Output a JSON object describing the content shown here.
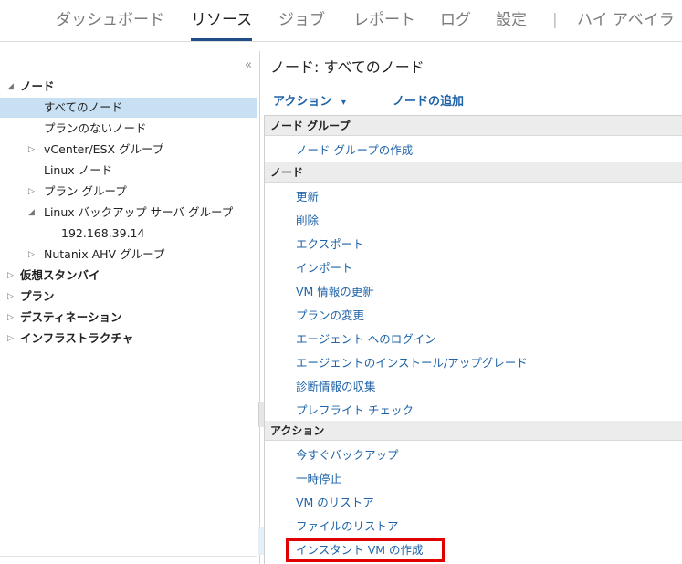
{
  "topnav": {
    "tabs": [
      {
        "label": "ダッシュボード"
      },
      {
        "label": "リソース"
      },
      {
        "label": "ジョブ"
      },
      {
        "label": "レポート"
      },
      {
        "label": "ログ"
      },
      {
        "label": "設定"
      },
      {
        "label": "ハイ アベイラ"
      }
    ],
    "separator": "|",
    "active_index": 1
  },
  "tree": {
    "collapse_glyph": "«",
    "items": [
      {
        "label": "ノード"
      },
      {
        "label": "すべてのノード"
      },
      {
        "label": "プランのないノード"
      },
      {
        "label": "vCenter/ESX グループ"
      },
      {
        "label": "Linux ノード"
      },
      {
        "label": "プラン グループ"
      },
      {
        "label": "Linux バックアップ サーバ グループ"
      },
      {
        "label": "192.168.39.14"
      },
      {
        "label": "Nutanix AHV グループ"
      },
      {
        "label": "仮想スタンバイ"
      },
      {
        "label": "プラン"
      },
      {
        "label": "デスティネーション"
      },
      {
        "label": "インフラストラクチャ"
      }
    ],
    "selected": "すべてのノード"
  },
  "main": {
    "title": "ノード: すべてのノード",
    "toolbar": {
      "actions_label": "アクション",
      "actions_arrow": "▾",
      "add_node_label": "ノードの追加"
    },
    "menu": {
      "sections": [
        {
          "header": "ノード グループ",
          "items": [
            "ノード グループの作成"
          ]
        },
        {
          "header": "ノード",
          "items": [
            "更新",
            "削除",
            "エクスポート",
            "インポート",
            "VM 情報の更新",
            "プランの変更",
            "エージェント へのログイン",
            "エージェントのインストール/アップグレード",
            "診断情報の収集",
            "プレフライト チェック"
          ]
        },
        {
          "header": "アクション",
          "items": [
            "今すぐバックアップ",
            "一時停止",
            "VM のリストア",
            "ファイルのリストア",
            "インスタント VM の作成"
          ]
        }
      ]
    },
    "highlighted_item": "インスタント VM の作成"
  },
  "colors": {
    "link": "#1f63a8",
    "selected_row": "#c8e0f4",
    "section_header": "#ececec",
    "highlight_border": "#e00000",
    "active_tab_underline": "#1f4f86"
  }
}
